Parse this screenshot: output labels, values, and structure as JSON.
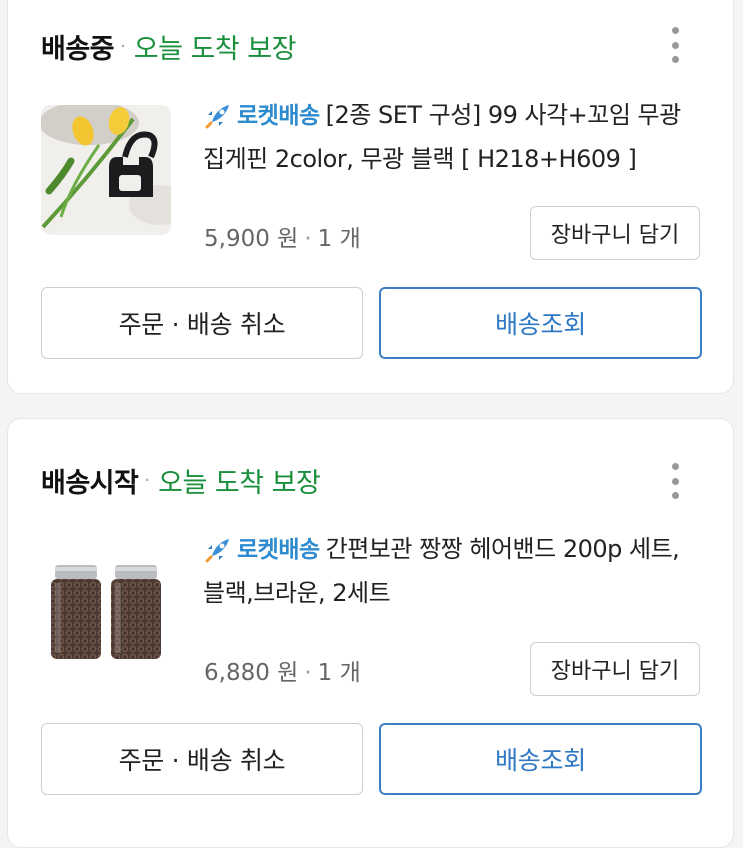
{
  "orders": [
    {
      "status": "배송중",
      "delivery_guarantee": "오늘 도착 보장",
      "delivery_badge": "로켓배송",
      "product_title": "[2종 SET 구성] 99 사각+꼬임 무광 집게핀 2color, 무광 블랙 [ H218+H609 ]",
      "price": "5,900 원",
      "quantity": "1 개",
      "add_to_cart_label": "장바구니 담기",
      "cancel_label": "주문 · 배송 취소",
      "track_label": "배송조회"
    },
    {
      "status": "배송시작",
      "delivery_guarantee": "오늘 도착 보장",
      "delivery_badge": "로켓배송",
      "product_title": "간편보관 짱짱 헤어밴드 200p 세트, 블랙,브라운, 2세트",
      "price": "6,880 원",
      "quantity": "1 개",
      "add_to_cart_label": "장바구니 담기",
      "cancel_label": "주문 · 배송 취소",
      "track_label": "배송조회"
    }
  ],
  "colors": {
    "guarantee_green": "#1a8f3c",
    "rocket_blue": "#2d8bd0",
    "track_button_border": "#3b7fc4"
  },
  "icons": {
    "more": "more-vertical-icon",
    "rocket": "rocket-icon"
  }
}
